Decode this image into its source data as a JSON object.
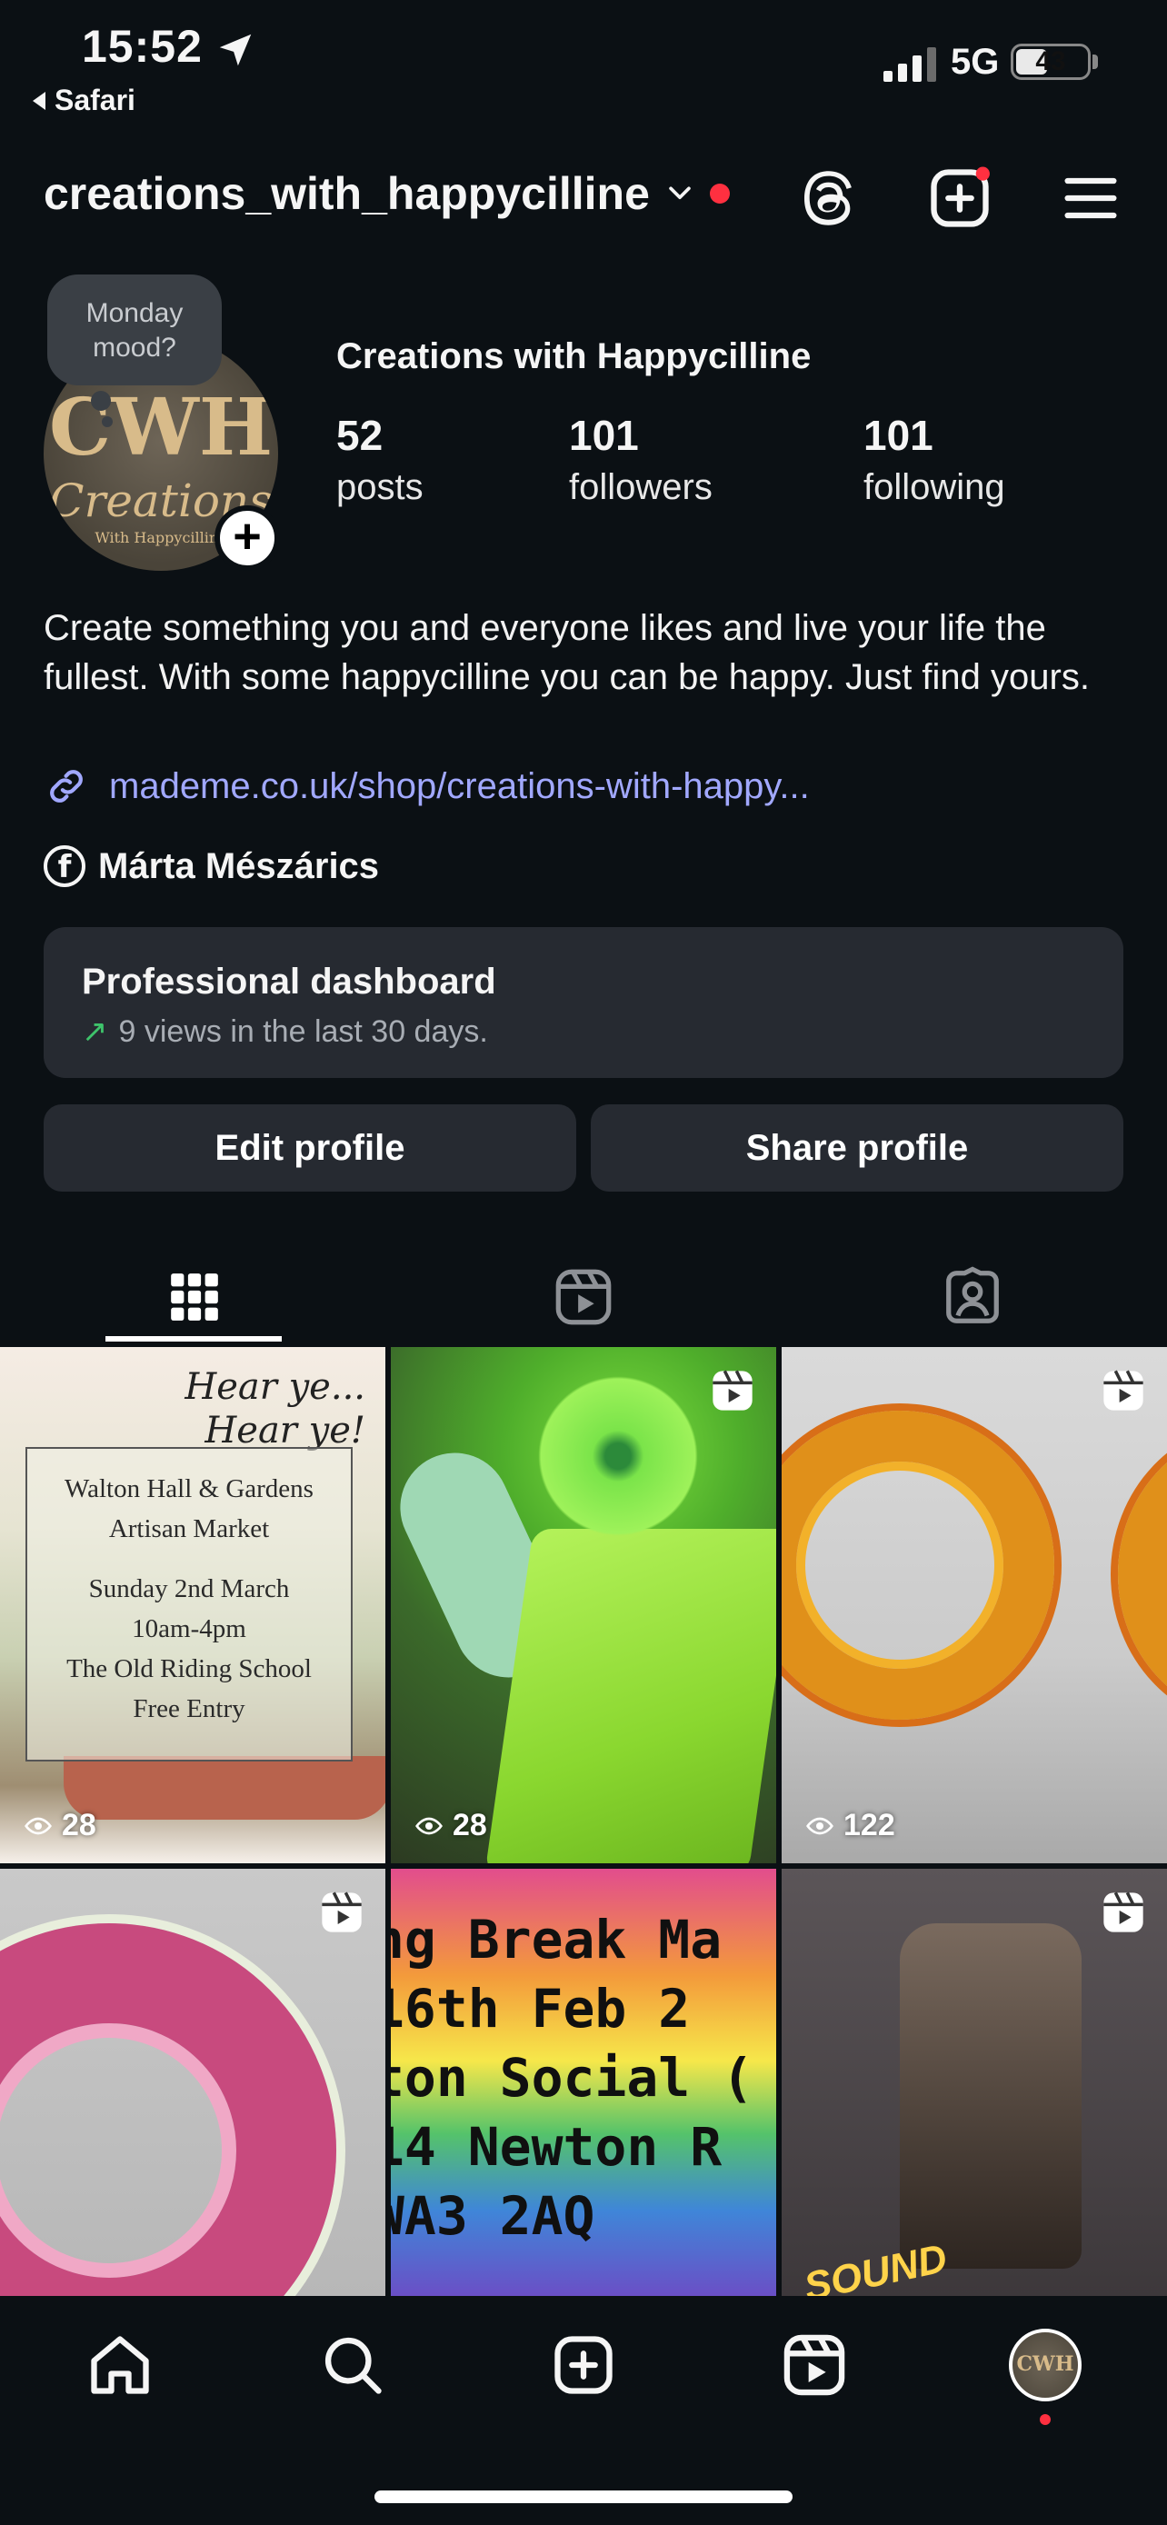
{
  "status_bar": {
    "time": "15:52",
    "back_app": "Safari",
    "network": "5G",
    "battery": "43"
  },
  "header": {
    "username": "creations_with_happycilline"
  },
  "profile": {
    "note": "Monday mood?",
    "avatar_logo": "CWH",
    "avatar_script": "Creations",
    "avatar_small": "With Happycilline",
    "display_name": "Creations with Happycilline",
    "stats": [
      {
        "value": "52",
        "label": "posts"
      },
      {
        "value": "101",
        "label": "followers"
      },
      {
        "value": "101",
        "label": "following"
      }
    ],
    "bio": "Create something you and everyone likes and live your life the fullest. With some happycilline you can be happy. Just find yours.",
    "link": "mademe.co.uk/shop/creations-with-happy...",
    "facebook_name": "Márta Mészárics"
  },
  "dashboard": {
    "title": "Professional dashboard",
    "subtitle": "9 views in the last 30 days."
  },
  "buttons": {
    "edit": "Edit profile",
    "share": "Share profile"
  },
  "tabs": [
    {
      "icon": "grid-icon",
      "active": true
    },
    {
      "icon": "reels-icon",
      "active": false
    },
    {
      "icon": "tagged-icon",
      "active": false
    }
  ],
  "posts": {
    "p1": {
      "title_line1": "Hear ye...",
      "title_line2": "Hear ye!",
      "lines": [
        "Walton Hall & Gardens",
        "Artisan Market",
        "",
        "Sunday 2nd March",
        "10am-4pm",
        "The Old Riding School",
        "Free Entry"
      ],
      "views": "28"
    },
    "p2": {
      "views": "28"
    },
    "p3": {
      "views": "122"
    },
    "p5": {
      "lines": [
        "ng Break Ma",
        " 16th Feb 2",
        "ton Social (",
        "14 Newton R",
        " WA3 2AQ"
      ]
    },
    "p6": {
      "sticker": "SOUND"
    }
  },
  "nav": {
    "avatar_text": "CWH",
    "items": [
      "home-icon",
      "search-icon",
      "create-icon",
      "reels-icon",
      "profile-avatar"
    ]
  },
  "colors": {
    "background": "#0b1014",
    "card": "#262a31",
    "link": "#a1a8ff",
    "notification": "#ff3040",
    "trend_up": "#3ec36b"
  }
}
